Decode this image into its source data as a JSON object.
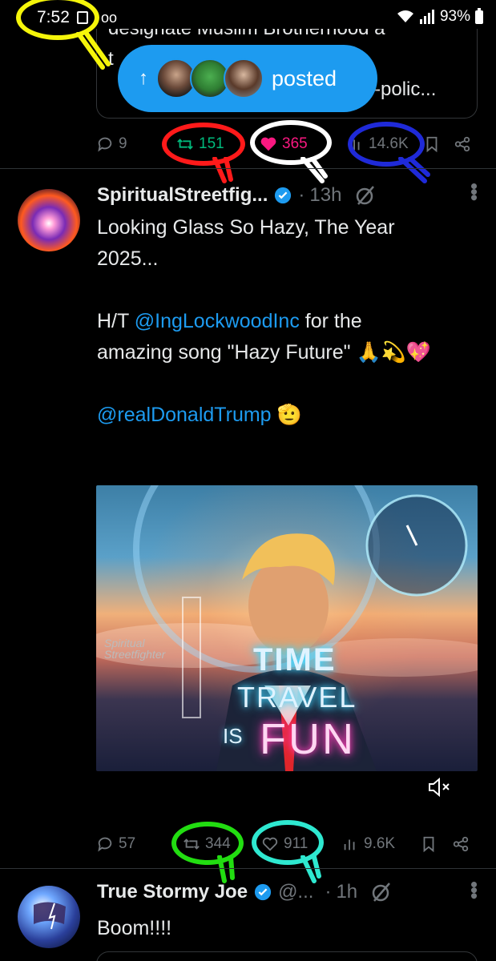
{
  "status_bar": {
    "time": "7:52",
    "battery": "93%"
  },
  "quoted_tweet": {
    "line1": "designate Muslim Brotherhood a",
    "line2": "t",
    "line3": "-polic..."
  },
  "posted_pill": {
    "label": "posted"
  },
  "tweet1_actions": {
    "replies": "9",
    "reposts": "151",
    "likes": "365",
    "views": "14.6K"
  },
  "tweet2": {
    "name": "SpiritualStreetfig...",
    "separator": "·",
    "time": "13h",
    "text_line1": "Looking Glass So Hazy, The Year",
    "text_line2": "2025...",
    "ht_prefix": "H/T ",
    "ht_mention": "@IngLockwoodInc",
    "ht_suffix": " for the",
    "song_line": "amazing song \"Hazy Future\" 🙏💫💖",
    "mention_trump": "@realDonaldTrump",
    "mention_emoji": "🫡",
    "media_text": {
      "watermark": "Spiritual Streetfighter",
      "time": "TIME",
      "travel": "TRAVEL",
      "is": "IS",
      "fun": "FUN"
    },
    "actions": {
      "replies": "57",
      "reposts": "344",
      "likes": "911",
      "views": "9.6K"
    }
  },
  "tweet3": {
    "name": "True Stormy Joe",
    "handle": "@...",
    "separator": "·",
    "time": "1h",
    "text": "Boom!!!!"
  },
  "colors": {
    "accent": "#1d9bf0",
    "repost_green": "#00ba7c",
    "like_pink": "#f91880",
    "muted": "#71767b",
    "annotation_yellow": "#f5f50a",
    "annotation_red": "#ff1a1a",
    "annotation_white": "#ffffff",
    "annotation_blue": "#1f2ad8",
    "annotation_green": "#22dd11",
    "annotation_cyan": "#2ee8d0"
  }
}
